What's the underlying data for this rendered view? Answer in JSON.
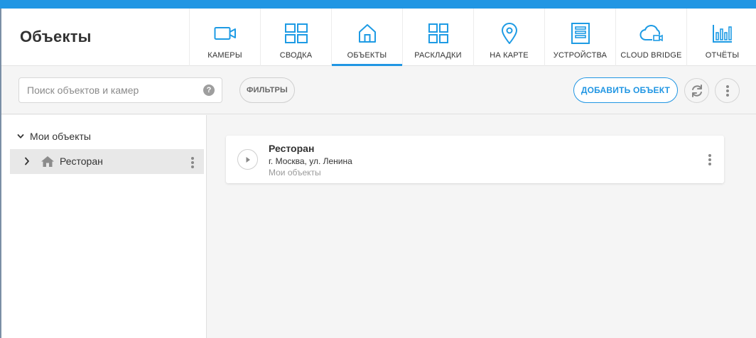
{
  "page": {
    "title": "Объекты"
  },
  "nav": [
    {
      "label": "КАМЕРЫ",
      "icon": "camera-icon"
    },
    {
      "label": "СВОДКА",
      "icon": "summary-grid-icon"
    },
    {
      "label": "ОБЪЕКТЫ",
      "icon": "house-icon",
      "active": true
    },
    {
      "label": "РАСКЛАДКИ",
      "icon": "layouts-grid-icon"
    },
    {
      "label": "НА КАРТЕ",
      "icon": "map-pin-icon"
    },
    {
      "label": "УСТРОЙСТВА",
      "icon": "device-rack-icon"
    },
    {
      "label": "CLOUD BRIDGE",
      "icon": "cloud-bridge-icon"
    },
    {
      "label": "ОТЧЁТЫ",
      "icon": "reports-bars-icon"
    }
  ],
  "toolbar": {
    "search_placeholder": "Поиск объектов и камер",
    "help_glyph": "?",
    "filter_label": "ФИЛЬТРЫ",
    "add_label": "ДОБАВИТЬ ОБЪЕКТ"
  },
  "sidebar": {
    "root_label": "Мои объекты",
    "items": [
      {
        "label": "Ресторан"
      }
    ]
  },
  "objects": [
    {
      "name": "Ресторан",
      "address": "г. Москва, ул. Ленина",
      "group": "Мои объекты"
    }
  ],
  "colors": {
    "accent": "#2196e3",
    "icon_blue": "#1e9be4",
    "selected_bg": "#e8e8e8"
  }
}
